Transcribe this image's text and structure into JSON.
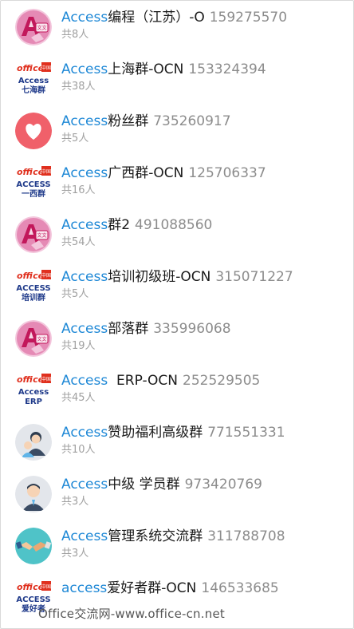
{
  "groups": [
    {
      "kw": "Access",
      "name": "编程（江苏）-O",
      "num": "159275570",
      "count": "共8人",
      "icon": "access-app-icon"
    },
    {
      "kw": "Access",
      "name": "上海群-OCN",
      "num": "153324394",
      "count": "共38人",
      "icon": "office-logo-icon",
      "sub": "Access",
      "sub2": "七海群"
    },
    {
      "kw": "Access",
      "name": "粉丝群",
      "num": "735260917",
      "count": "共5人",
      "icon": "heart-icon"
    },
    {
      "kw": "Access",
      "name": "广西群-OCN",
      "num": "125706337",
      "count": "共16人",
      "icon": "office-logo-icon",
      "sub": "ACCESS",
      "sub2": "一西群"
    },
    {
      "kw": "Access",
      "name": "群2",
      "num": "491088560",
      "count": "共54人",
      "icon": "access-app-icon"
    },
    {
      "kw": "Access",
      "name": "培训初级班-OCN",
      "num": "315071227",
      "count": "共5人",
      "icon": "office-logo-icon",
      "sub": "ACCESS",
      "sub2": "培训群"
    },
    {
      "kw": "Access",
      "name": "部落群",
      "num": "335996068",
      "count": "共19人",
      "icon": "access-app-icon"
    },
    {
      "kw": "Access",
      "name": "  ERP-OCN",
      "num": "252529505",
      "count": "共45人",
      "icon": "office-logo-icon",
      "sub": "Access",
      "sub2": "ERP"
    },
    {
      "kw": "Access",
      "name": "赞助福利高级群",
      "num": "771551331",
      "count": "共10人",
      "icon": "people-icon"
    },
    {
      "kw": "Access",
      "name": "中级 学员群",
      "num": "973420769",
      "count": "共3人",
      "icon": "person-icon"
    },
    {
      "kw": "Access",
      "name": "管理系统交流群",
      "num": "311788708",
      "count": "共3人",
      "icon": "handshake-icon"
    },
    {
      "kw": "access",
      "name": "爱好者群-OCN",
      "num": "146533685",
      "count": "",
      "icon": "office-logo-icon",
      "sub": "ACCESS",
      "sub2": "爱好者"
    }
  ],
  "watermark": "Office交流网-www.office-cn.net",
  "logo_text": "office",
  "logo_badge": "中国"
}
